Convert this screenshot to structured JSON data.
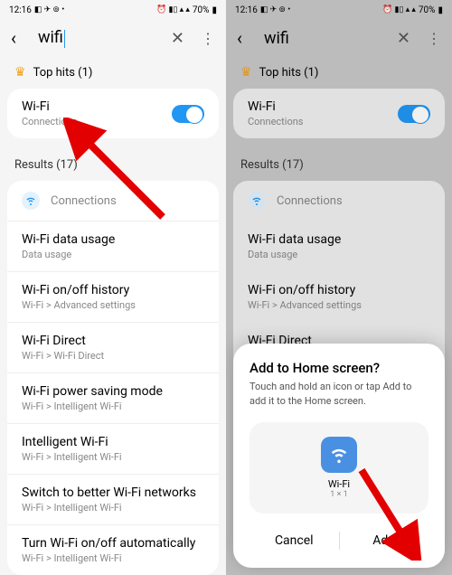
{
  "status": {
    "time": "12:16",
    "battery": "70%"
  },
  "search": {
    "query": "wifi"
  },
  "top_hits": {
    "label": "Top hits (1)"
  },
  "wifi_item": {
    "title": "Wi-Fi",
    "sub": "Connections"
  },
  "results": {
    "label": "Results (17)"
  },
  "connections": {
    "label": "Connections"
  },
  "items": [
    {
      "title": "Wi-Fi data usage",
      "sub": "Data usage"
    },
    {
      "title": "Wi-Fi on/off history",
      "sub": "Wi-Fi > Advanced settings"
    },
    {
      "title": "Wi-Fi Direct",
      "sub": "Wi-Fi > Wi-Fi Direct"
    },
    {
      "title": "Wi-Fi power saving mode",
      "sub": "Wi-Fi > Intelligent Wi-Fi"
    },
    {
      "title": "Intelligent Wi-Fi",
      "sub": "Wi-Fi > Intelligent Wi-Fi"
    },
    {
      "title": "Switch to better Wi-Fi networks",
      "sub": "Wi-Fi > Intelligent Wi-Fi"
    },
    {
      "title": "Turn Wi-Fi on/off automatically",
      "sub": "Wi-Fi > Intelligent Wi-Fi"
    }
  ],
  "sheet": {
    "title": "Add to Home screen?",
    "desc": "Touch and hold an icon or tap Add to add it to the Home screen.",
    "app_label": "Wi-Fi",
    "app_size": "1 × 1",
    "cancel": "Cancel",
    "add": "Add"
  }
}
